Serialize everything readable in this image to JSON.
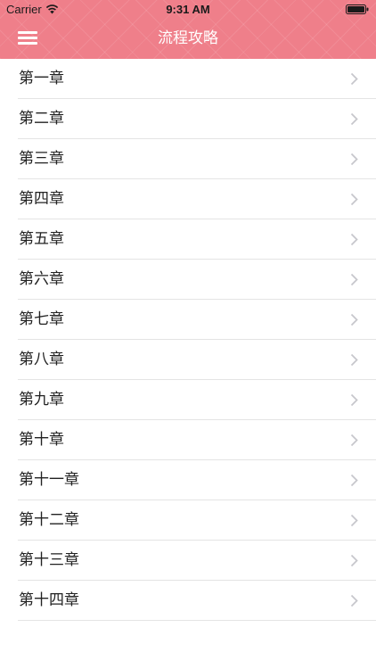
{
  "status_bar": {
    "carrier": "Carrier",
    "time": "9:31 AM",
    "wifi_icon": "wifi-icon",
    "battery_icon": "battery-full-icon"
  },
  "nav": {
    "title": "流程攻略",
    "menu_icon": "hamburger-menu-icon",
    "bar_color": "#ef7f8a"
  },
  "chapters": [
    {
      "label": "第一章"
    },
    {
      "label": "第二章"
    },
    {
      "label": "第三章"
    },
    {
      "label": "第四章"
    },
    {
      "label": "第五章"
    },
    {
      "label": "第六章"
    },
    {
      "label": "第七章"
    },
    {
      "label": "第八章"
    },
    {
      "label": "第九章"
    },
    {
      "label": "第十章"
    },
    {
      "label": "第十一章"
    },
    {
      "label": "第十二章"
    },
    {
      "label": "第十三章"
    },
    {
      "label": "第十四章"
    }
  ]
}
